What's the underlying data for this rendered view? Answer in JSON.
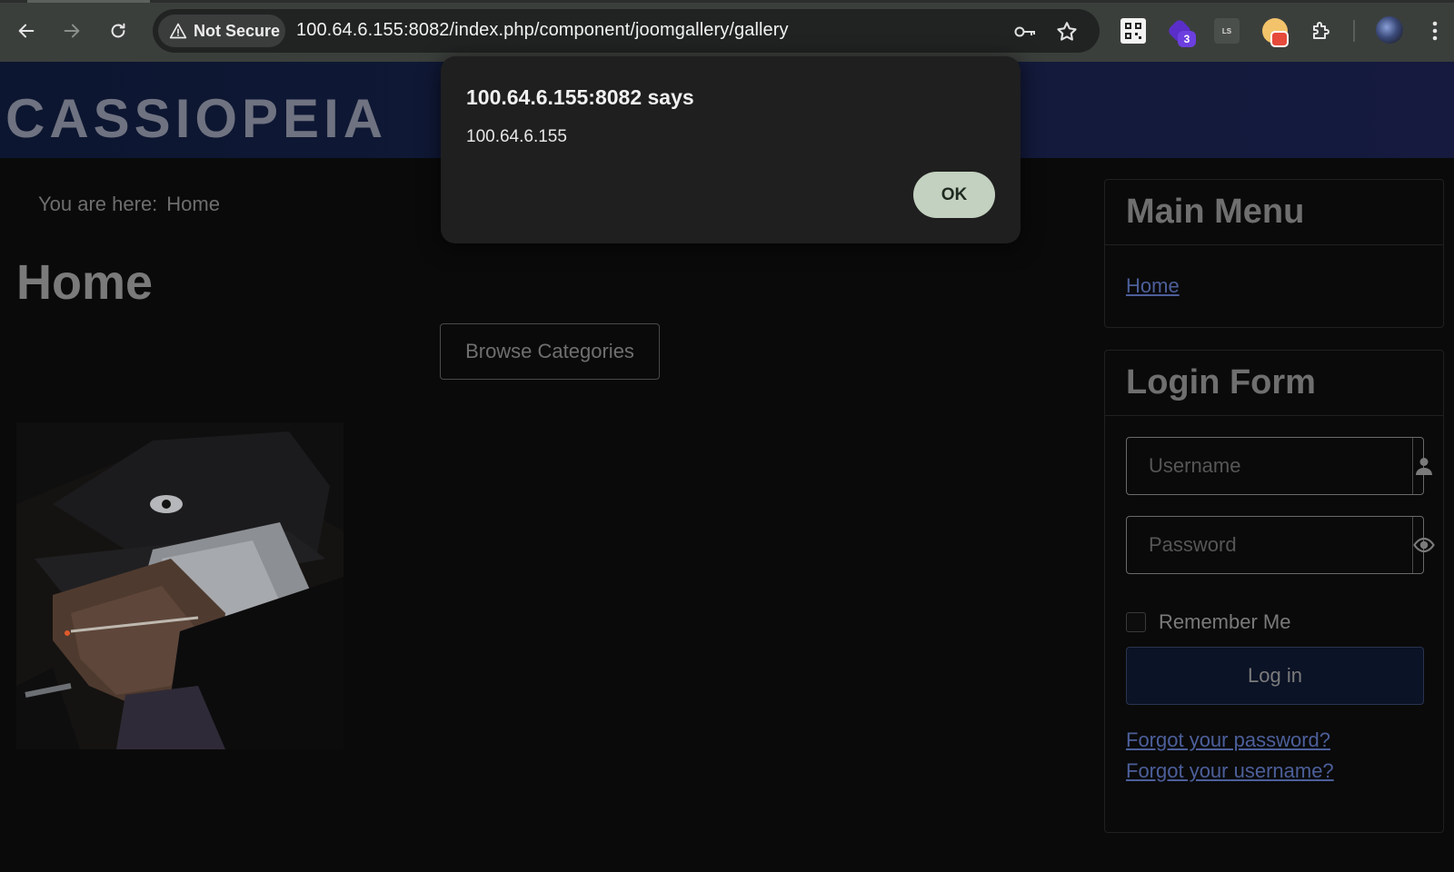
{
  "browser": {
    "security_label": "Not Secure",
    "url": "100.64.6.155:8082/index.php/component/joomgallery/gallery",
    "extension_badge_count": "3",
    "ls_extension_text": "LS"
  },
  "site": {
    "brand": "CASSIOPEIA"
  },
  "breadcrumb": {
    "prefix": "You are here:",
    "current": "Home"
  },
  "main": {
    "title": "Home",
    "browse_button": "Browse Categories"
  },
  "sidebar": {
    "main_menu": {
      "title": "Main Menu",
      "items": [
        {
          "label": "Home"
        }
      ]
    },
    "login_form": {
      "title": "Login Form",
      "username_placeholder": "Username",
      "password_placeholder": "Password",
      "remember_label": "Remember Me",
      "login_button": "Log in",
      "forgot_password": "Forgot your password?",
      "forgot_username": "Forgot your username?"
    }
  },
  "dialog": {
    "title": "100.64.6.155:8082 says",
    "message": "100.64.6.155",
    "ok_label": "OK"
  },
  "colors": {
    "page_bg": "#0a0a0a",
    "header_bg": "#121a3a",
    "link": "#4c5f9a",
    "dialog_ok_bg": "#c3d1c0"
  }
}
